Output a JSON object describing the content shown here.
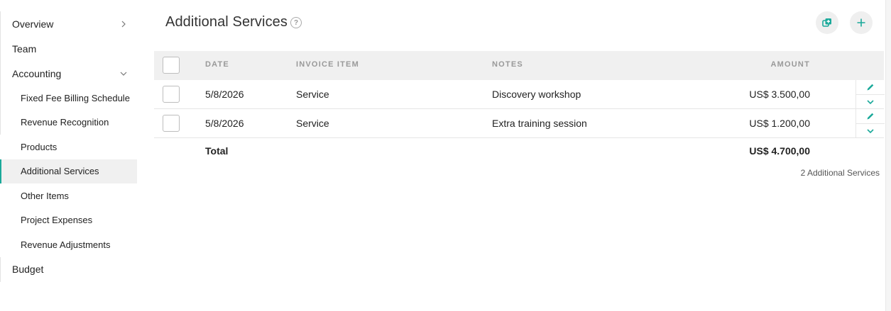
{
  "sidebar": {
    "items": [
      {
        "label": "Overview",
        "level": "top",
        "chevron": "chevron-right-icon"
      },
      {
        "label": "Team",
        "level": "top"
      },
      {
        "label": "Accounting",
        "level": "top",
        "chevron": "chevron-down-icon"
      },
      {
        "label": "Fixed Fee Billing Schedule",
        "level": "sub"
      },
      {
        "label": "Revenue Recognition",
        "level": "sub"
      },
      {
        "label": "Products",
        "level": "sub"
      },
      {
        "label": "Additional Services",
        "level": "sub",
        "active": true
      },
      {
        "label": "Other Items",
        "level": "sub"
      },
      {
        "label": "Project Expenses",
        "level": "sub"
      },
      {
        "label": "Revenue Adjustments",
        "level": "sub"
      },
      {
        "label": "Budget",
        "level": "top"
      }
    ]
  },
  "header": {
    "title": "Additional Services",
    "help_glyph": "?",
    "copy_button_icon": "copy-add-icon",
    "add_button_icon": "plus-icon"
  },
  "table": {
    "columns": {
      "date": "DATE",
      "invoice_item": "INVOICE ITEM",
      "notes": "NOTES",
      "amount": "AMOUNT"
    },
    "rows": [
      {
        "date": "5/8/2026",
        "invoice_item": "Service",
        "notes": "Discovery workshop",
        "amount": "US$ 3.500,00"
      },
      {
        "date": "5/8/2026",
        "invoice_item": "Service",
        "notes": "Extra training session",
        "amount": "US$ 1.200,00"
      }
    ],
    "total_label": "Total",
    "total_amount": "US$ 4.700,00"
  },
  "footer": {
    "count_text": "2 Additional Services"
  },
  "colors": {
    "accent": "#1aa99a",
    "header_bg": "#f0f0f0"
  }
}
